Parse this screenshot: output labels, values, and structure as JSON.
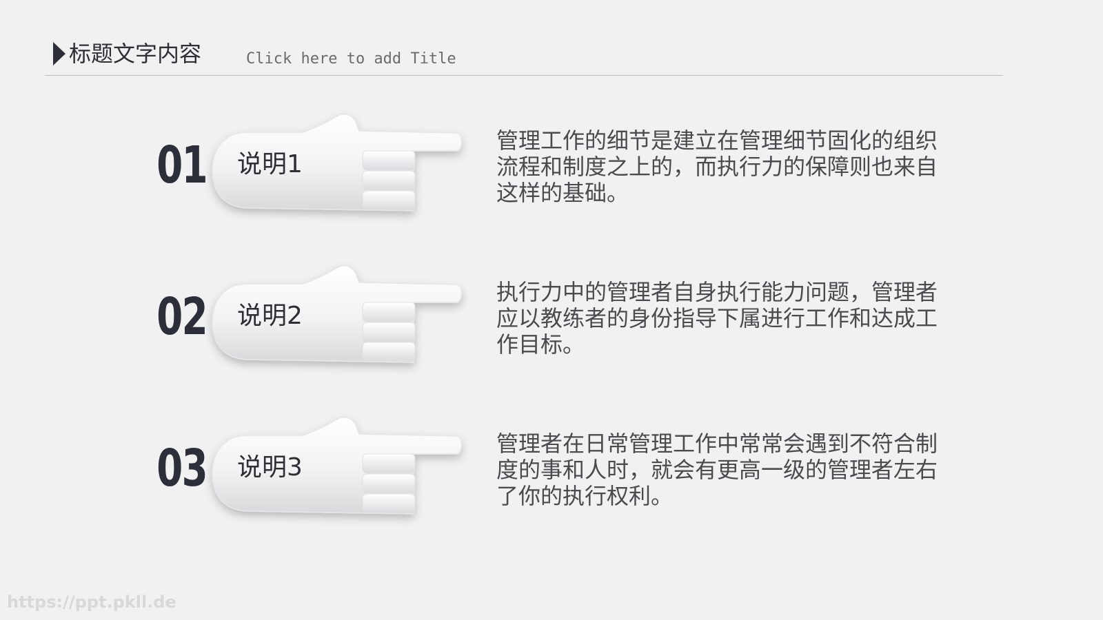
{
  "header": {
    "title": "标题文字内容",
    "subtitle": "Click here to add Title"
  },
  "items": [
    {
      "number": "01",
      "label": "说明1",
      "description": "管理工作的细节是建立在管理细节固化的组织流程和制度之上的，而执行力的保障则也来自这样的基础。"
    },
    {
      "number": "02",
      "label": "说明2",
      "description": "执行力中的管理者自身执行能力问题，管理者应以教练者的身份指导下属进行工作和达成工作目标。"
    },
    {
      "number": "03",
      "label": "说明3",
      "description": "管理者在日常管理工作中常常会遇到不符合制度的事和人时，就会有更高一级的管理者左右了你的执行权利。"
    }
  ],
  "watermark": "https://ppt.pkll.de",
  "colors": {
    "background": "#f1f1f2",
    "accent": "#2c2f3a",
    "text": "#4a4a4f"
  }
}
